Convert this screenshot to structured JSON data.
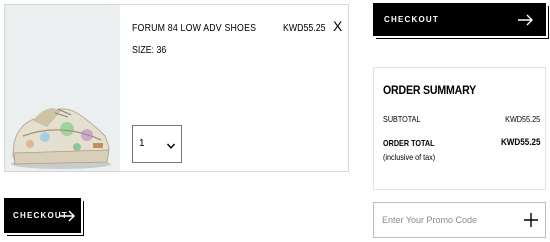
{
  "cart_item": {
    "name": "FORUM 84 LOW ADV SHOES",
    "price": "KWD55.25",
    "size": "SIZE: 36",
    "remove_label": "X",
    "quantity": "1",
    "image_icon": "sneaker-product-image"
  },
  "checkout_top": {
    "label": "CHECKOUT",
    "icon": "arrow-right-icon"
  },
  "checkout_bottom": {
    "label": "CHECKOUT",
    "icon": "arrow-right-icon"
  },
  "order_summary": {
    "title": "ORDER SUMMARY",
    "subtotal_label": "SUBTOTAL",
    "subtotal_value": "KWD55.25",
    "total_label": "ORDER TOTAL",
    "total_value": "KWD55.25",
    "tax_note": "(inclusive of tax)"
  },
  "promo": {
    "placeholder": "Enter Your Promo Code",
    "icon": "plus-icon"
  },
  "colors": {
    "button_bg": "#000000",
    "button_text": "#ffffff",
    "border": "#d6d6d6",
    "image_bg": "#eceff0"
  }
}
